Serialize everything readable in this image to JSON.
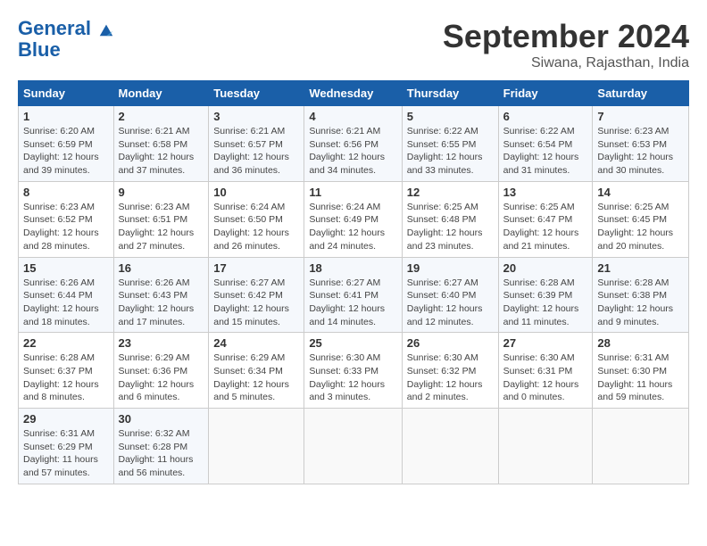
{
  "header": {
    "logo_line1": "General",
    "logo_line2": "Blue",
    "month_title": "September 2024",
    "subtitle": "Siwana, Rajasthan, India"
  },
  "columns": [
    "Sunday",
    "Monday",
    "Tuesday",
    "Wednesday",
    "Thursday",
    "Friday",
    "Saturday"
  ],
  "weeks": [
    [
      {
        "day": "1",
        "info": "Sunrise: 6:20 AM\nSunset: 6:59 PM\nDaylight: 12 hours\nand 39 minutes."
      },
      {
        "day": "2",
        "info": "Sunrise: 6:21 AM\nSunset: 6:58 PM\nDaylight: 12 hours\nand 37 minutes."
      },
      {
        "day": "3",
        "info": "Sunrise: 6:21 AM\nSunset: 6:57 PM\nDaylight: 12 hours\nand 36 minutes."
      },
      {
        "day": "4",
        "info": "Sunrise: 6:21 AM\nSunset: 6:56 PM\nDaylight: 12 hours\nand 34 minutes."
      },
      {
        "day": "5",
        "info": "Sunrise: 6:22 AM\nSunset: 6:55 PM\nDaylight: 12 hours\nand 33 minutes."
      },
      {
        "day": "6",
        "info": "Sunrise: 6:22 AM\nSunset: 6:54 PM\nDaylight: 12 hours\nand 31 minutes."
      },
      {
        "day": "7",
        "info": "Sunrise: 6:23 AM\nSunset: 6:53 PM\nDaylight: 12 hours\nand 30 minutes."
      }
    ],
    [
      {
        "day": "8",
        "info": "Sunrise: 6:23 AM\nSunset: 6:52 PM\nDaylight: 12 hours\nand 28 minutes."
      },
      {
        "day": "9",
        "info": "Sunrise: 6:23 AM\nSunset: 6:51 PM\nDaylight: 12 hours\nand 27 minutes."
      },
      {
        "day": "10",
        "info": "Sunrise: 6:24 AM\nSunset: 6:50 PM\nDaylight: 12 hours\nand 26 minutes."
      },
      {
        "day": "11",
        "info": "Sunrise: 6:24 AM\nSunset: 6:49 PM\nDaylight: 12 hours\nand 24 minutes."
      },
      {
        "day": "12",
        "info": "Sunrise: 6:25 AM\nSunset: 6:48 PM\nDaylight: 12 hours\nand 23 minutes."
      },
      {
        "day": "13",
        "info": "Sunrise: 6:25 AM\nSunset: 6:47 PM\nDaylight: 12 hours\nand 21 minutes."
      },
      {
        "day": "14",
        "info": "Sunrise: 6:25 AM\nSunset: 6:45 PM\nDaylight: 12 hours\nand 20 minutes."
      }
    ],
    [
      {
        "day": "15",
        "info": "Sunrise: 6:26 AM\nSunset: 6:44 PM\nDaylight: 12 hours\nand 18 minutes."
      },
      {
        "day": "16",
        "info": "Sunrise: 6:26 AM\nSunset: 6:43 PM\nDaylight: 12 hours\nand 17 minutes."
      },
      {
        "day": "17",
        "info": "Sunrise: 6:27 AM\nSunset: 6:42 PM\nDaylight: 12 hours\nand 15 minutes."
      },
      {
        "day": "18",
        "info": "Sunrise: 6:27 AM\nSunset: 6:41 PM\nDaylight: 12 hours\nand 14 minutes."
      },
      {
        "day": "19",
        "info": "Sunrise: 6:27 AM\nSunset: 6:40 PM\nDaylight: 12 hours\nand 12 minutes."
      },
      {
        "day": "20",
        "info": "Sunrise: 6:28 AM\nSunset: 6:39 PM\nDaylight: 12 hours\nand 11 minutes."
      },
      {
        "day": "21",
        "info": "Sunrise: 6:28 AM\nSunset: 6:38 PM\nDaylight: 12 hours\nand 9 minutes."
      }
    ],
    [
      {
        "day": "22",
        "info": "Sunrise: 6:28 AM\nSunset: 6:37 PM\nDaylight: 12 hours\nand 8 minutes."
      },
      {
        "day": "23",
        "info": "Sunrise: 6:29 AM\nSunset: 6:36 PM\nDaylight: 12 hours\nand 6 minutes."
      },
      {
        "day": "24",
        "info": "Sunrise: 6:29 AM\nSunset: 6:34 PM\nDaylight: 12 hours\nand 5 minutes."
      },
      {
        "day": "25",
        "info": "Sunrise: 6:30 AM\nSunset: 6:33 PM\nDaylight: 12 hours\nand 3 minutes."
      },
      {
        "day": "26",
        "info": "Sunrise: 6:30 AM\nSunset: 6:32 PM\nDaylight: 12 hours\nand 2 minutes."
      },
      {
        "day": "27",
        "info": "Sunrise: 6:30 AM\nSunset: 6:31 PM\nDaylight: 12 hours\nand 0 minutes."
      },
      {
        "day": "28",
        "info": "Sunrise: 6:31 AM\nSunset: 6:30 PM\nDaylight: 11 hours\nand 59 minutes."
      }
    ],
    [
      {
        "day": "29",
        "info": "Sunrise: 6:31 AM\nSunset: 6:29 PM\nDaylight: 11 hours\nand 57 minutes."
      },
      {
        "day": "30",
        "info": "Sunrise: 6:32 AM\nSunset: 6:28 PM\nDaylight: 11 hours\nand 56 minutes."
      },
      {
        "day": "",
        "info": ""
      },
      {
        "day": "",
        "info": ""
      },
      {
        "day": "",
        "info": ""
      },
      {
        "day": "",
        "info": ""
      },
      {
        "day": "",
        "info": ""
      }
    ]
  ]
}
